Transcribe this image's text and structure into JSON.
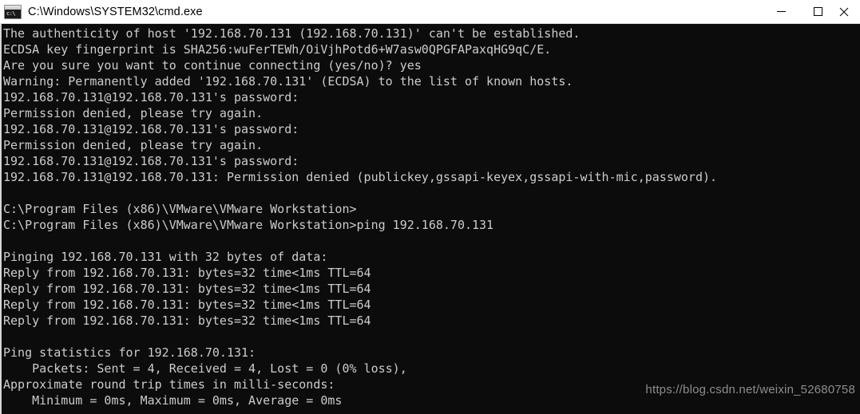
{
  "window": {
    "title": "C:\\Windows\\SYSTEM32\\cmd.exe",
    "icon": "cmd-console-icon",
    "icon_glyph": "c:\\",
    "controls": {
      "minimize_label": "Minimize",
      "maximize_label": "Maximize",
      "close_label": "Close"
    },
    "colors": {
      "titlebar_bg": "#ffffff",
      "console_bg": "#0c0c0c",
      "console_fg": "#cccccc",
      "watermark_fg": "#8d8d8d",
      "border": "#d6d6d6"
    }
  },
  "console": {
    "host_ip": "192.168.70.131",
    "prompt": "C:\\Program Files (x86)\\VMware\\VMware Workstation>",
    "lines": [
      "The authenticity of host '192.168.70.131 (192.168.70.131)' can't be established.",
      "ECDSA key fingerprint is SHA256:wuFerTEWh/OiVjhPotd6+W7asw0QPGFAPaxqHG9qC/E.",
      "Are you sure you want to continue connecting (yes/no)? yes",
      "Warning: Permanently added '192.168.70.131' (ECDSA) to the list of known hosts.",
      "192.168.70.131@192.168.70.131's password:",
      "Permission denied, please try again.",
      "192.168.70.131@192.168.70.131's password:",
      "Permission denied, please try again.",
      "192.168.70.131@192.168.70.131's password:",
      "192.168.70.131@192.168.70.131: Permission denied (publickey,gssapi-keyex,gssapi-with-mic,password).",
      "",
      "C:\\Program Files (x86)\\VMware\\VMware Workstation>",
      "C:\\Program Files (x86)\\VMware\\VMware Workstation>ping 192.168.70.131",
      "",
      "Pinging 192.168.70.131 with 32 bytes of data:",
      "Reply from 192.168.70.131: bytes=32 time<1ms TTL=64",
      "Reply from 192.168.70.131: bytes=32 time<1ms TTL=64",
      "Reply from 192.168.70.131: bytes=32 time<1ms TTL=64",
      "Reply from 192.168.70.131: bytes=32 time<1ms TTL=64",
      "",
      "Ping statistics for 192.168.70.131:",
      "    Packets: Sent = 4, Received = 4, Lost = 0 (0% loss),",
      "Approximate round trip times in milli-seconds:",
      "    Minimum = 0ms, Maximum = 0ms, Average = 0ms"
    ],
    "text": "The authenticity of host '192.168.70.131 (192.168.70.131)' can't be established.\nECDSA key fingerprint is SHA256:wuFerTEWh/OiVjhPotd6+W7asw0QPGFAPaxqHG9qC/E.\nAre you sure you want to continue connecting (yes/no)? yes\nWarning: Permanently added '192.168.70.131' (ECDSA) to the list of known hosts.\n192.168.70.131@192.168.70.131's password:\nPermission denied, please try again.\n192.168.70.131@192.168.70.131's password:\nPermission denied, please try again.\n192.168.70.131@192.168.70.131's password:\n192.168.70.131@192.168.70.131: Permission denied (publickey,gssapi-keyex,gssapi-with-mic,password).\n\nC:\\Program Files (x86)\\VMware\\VMware Workstation>\nC:\\Program Files (x86)\\VMware\\VMware Workstation>ping 192.168.70.131\n\nPinging 192.168.70.131 with 32 bytes of data:\nReply from 192.168.70.131: bytes=32 time<1ms TTL=64\nReply from 192.168.70.131: bytes=32 time<1ms TTL=64\nReply from 192.168.70.131: bytes=32 time<1ms TTL=64\nReply from 192.168.70.131: bytes=32 time<1ms TTL=64\n\nPing statistics for 192.168.70.131:\n    Packets: Sent = 4, Received = 4, Lost = 0 (0% loss),\nApproximate round trip times in milli-seconds:\n    Minimum = 0ms, Maximum = 0ms, Average = 0ms"
  },
  "watermark": {
    "text": "https://blog.csdn.net/weixin_52680758"
  }
}
